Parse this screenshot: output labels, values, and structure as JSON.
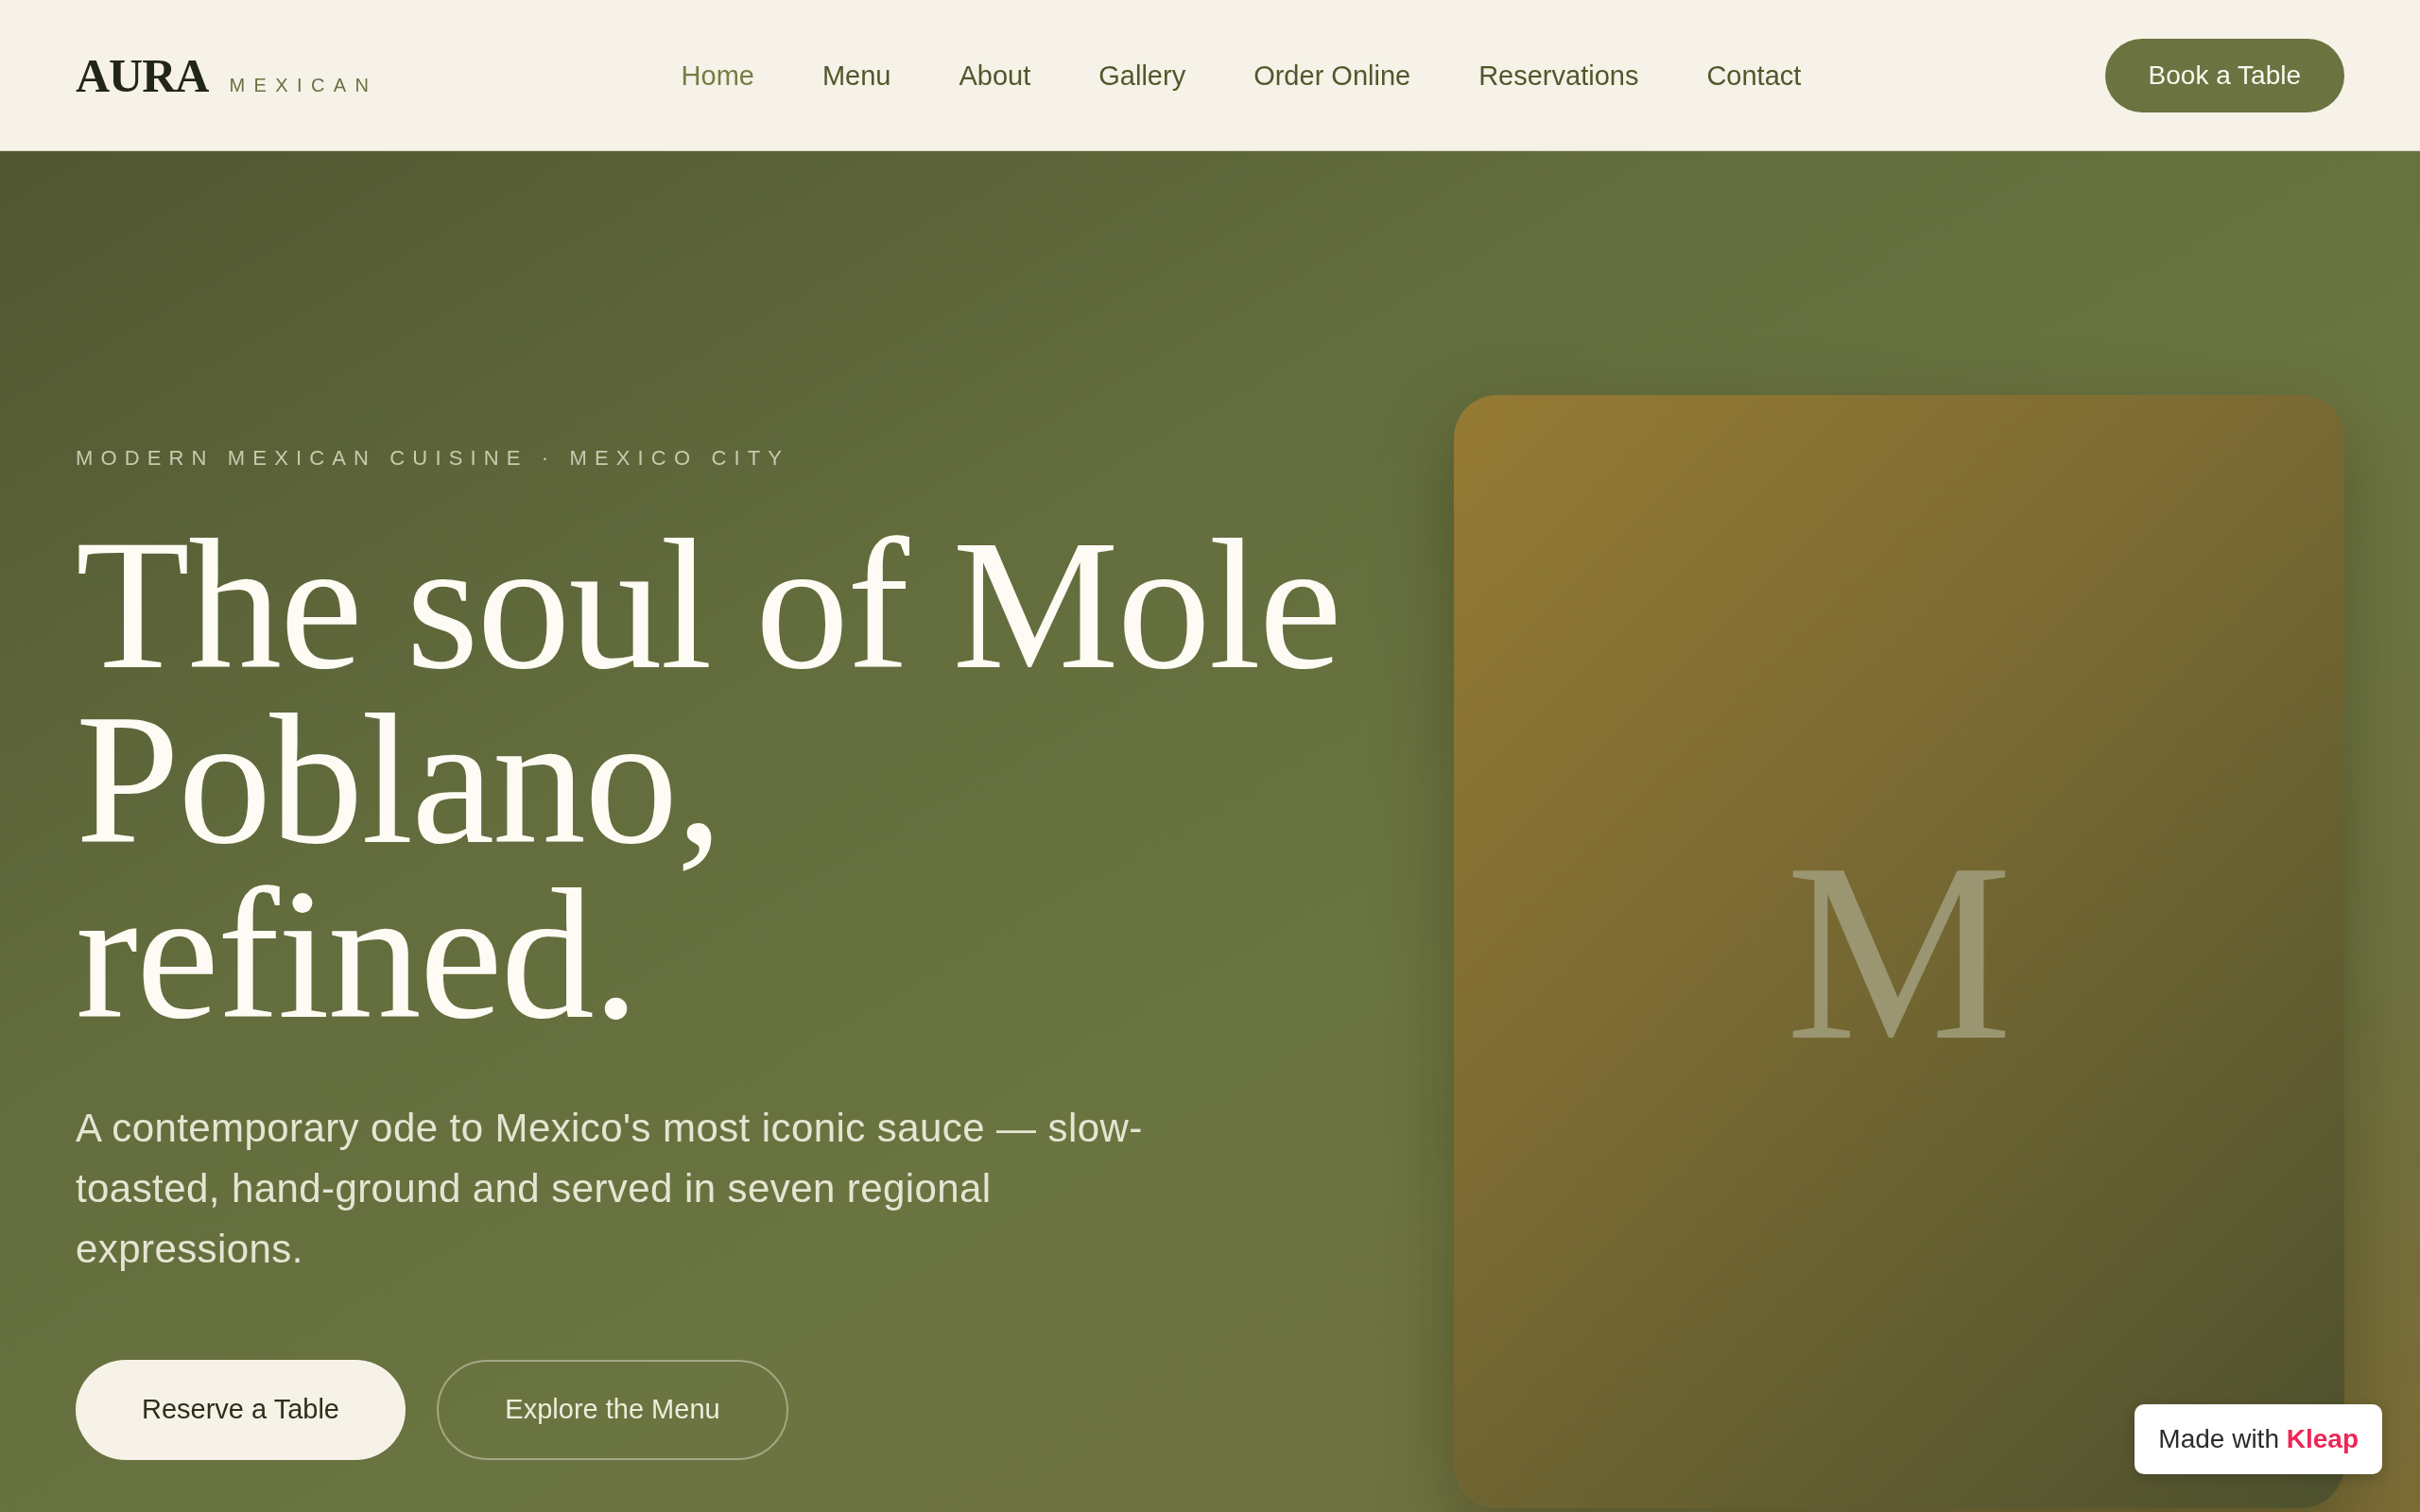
{
  "header": {
    "logo": {
      "wordmark": "AURA",
      "tagline": "MEXICAN"
    },
    "nav": [
      {
        "label": "Home",
        "selected": true
      },
      {
        "label": "Menu",
        "selected": false
      },
      {
        "label": "About",
        "selected": false
      },
      {
        "label": "Gallery",
        "selected": false
      },
      {
        "label": "Order Online",
        "selected": false
      },
      {
        "label": "Reservations",
        "selected": false
      },
      {
        "label": "Contact",
        "selected": false
      }
    ],
    "cta": "Book a Table"
  },
  "hero": {
    "eyebrow": "MODERN MEXICAN CUISINE · MEXICO CITY",
    "headline": "The soul of Mole\nPoblano,\nrefined.",
    "description": "A contemporary ode to Mexico's most iconic sauce — slow-toasted, hand-ground and served in seven regional expressions.",
    "buttons": [
      {
        "label": "Reserve a Table",
        "kind": "primary"
      },
      {
        "label": "Explore the Menu",
        "kind": "outline"
      }
    ],
    "card": {
      "monogram": "M"
    }
  },
  "badge": "Made with **Kleap**"
}
